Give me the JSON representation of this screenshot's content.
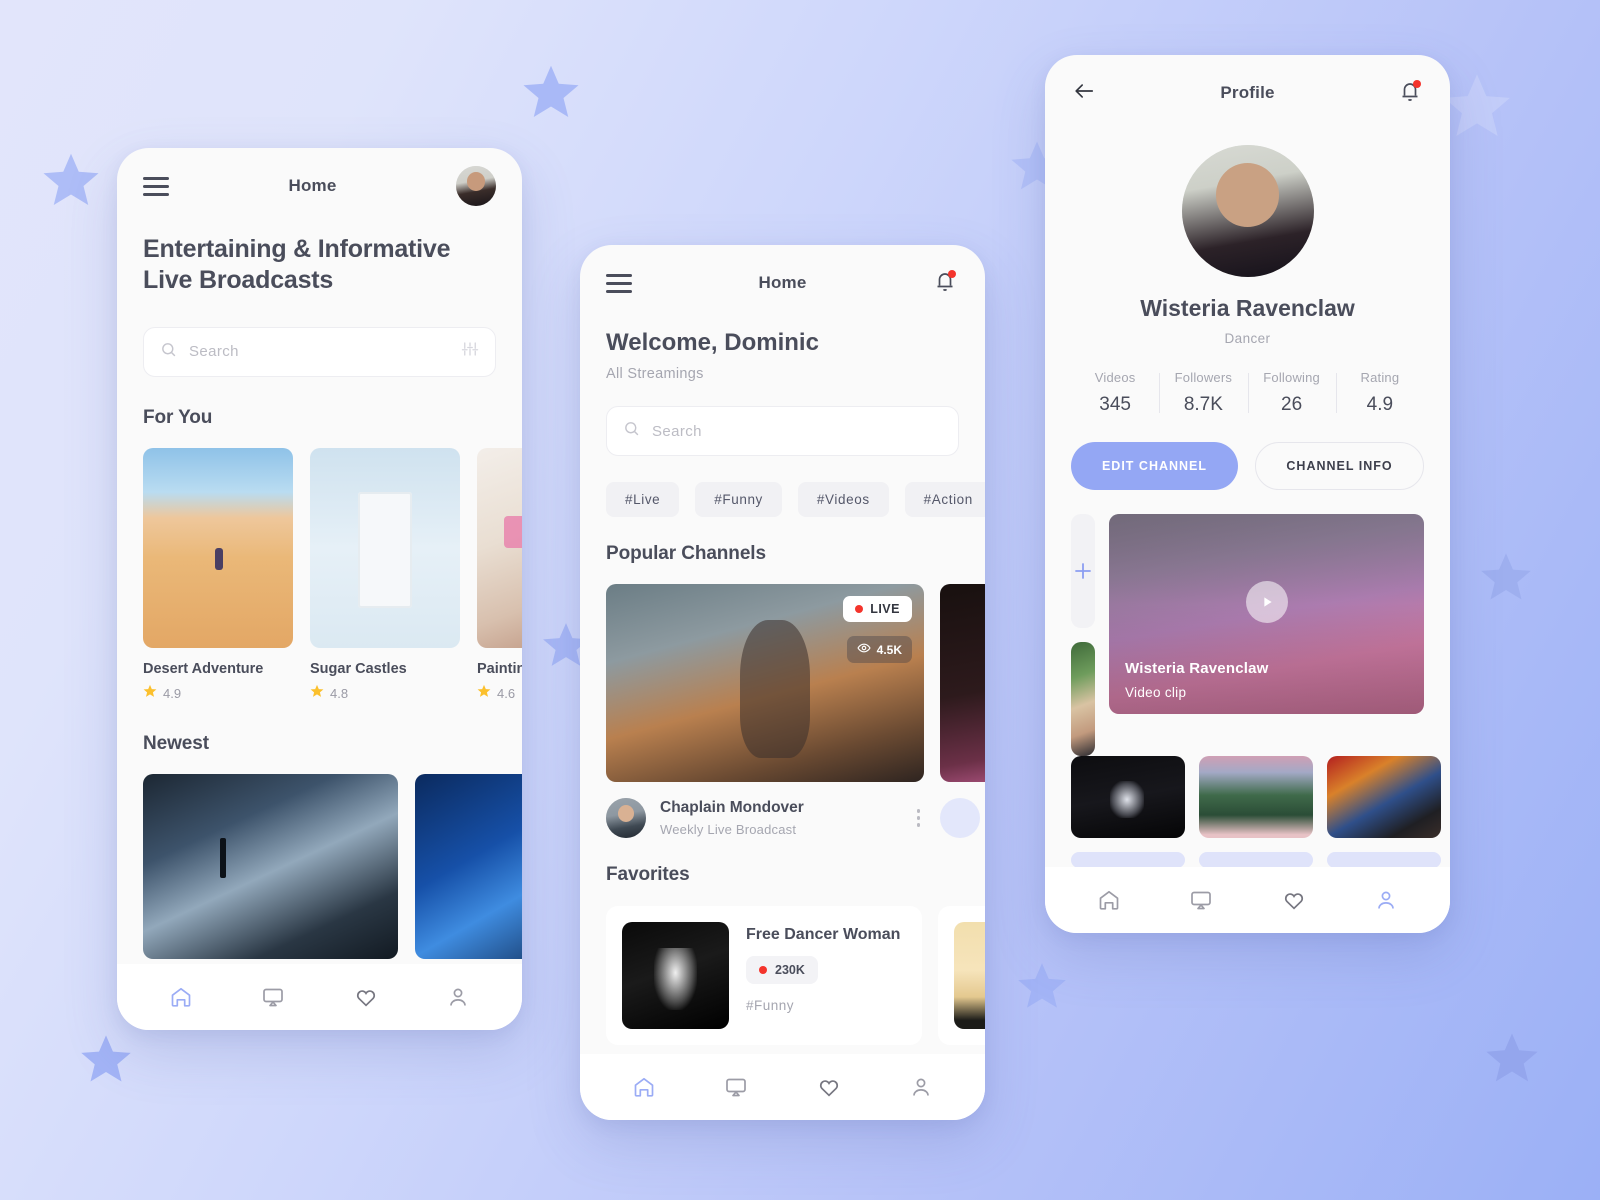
{
  "background": {
    "gradient_from": "#e2e5fb",
    "gradient_to": "#9bb0f6",
    "star_color": "#aebdf7"
  },
  "accent": "#94a7f4",
  "phone1": {
    "header": {
      "title": "Home",
      "menu_icon": "hamburger-icon",
      "avatar": "user-avatar"
    },
    "headline": "Entertaining & Informative Live Broadcasts",
    "search": {
      "placeholder": "Search",
      "icon": "search-icon",
      "filter_icon": "filter-sliders-icon"
    },
    "for_you": {
      "title": "For You",
      "cards": [
        {
          "title": "Desert Adventure",
          "rating": "4.9",
          "art": "desert"
        },
        {
          "title": "Sugar Castles",
          "rating": "4.8",
          "art": "sugar"
        },
        {
          "title": "Painting",
          "rating": "4.6",
          "art": "paint"
        }
      ]
    },
    "newest": {
      "title": "Newest",
      "cards": [
        {
          "art": "concert1"
        },
        {
          "art": "concert2"
        }
      ]
    },
    "nav": [
      {
        "name": "home",
        "icon": "home-icon",
        "active": true
      },
      {
        "name": "cast",
        "icon": "screen-cast-icon",
        "active": false
      },
      {
        "name": "favorites",
        "icon": "heart-icon",
        "active": false
      },
      {
        "name": "profile",
        "icon": "person-icon",
        "active": false
      }
    ]
  },
  "phone2": {
    "header": {
      "title": "Home",
      "menu_icon": "hamburger-icon",
      "bell_icon": "bell-icon"
    },
    "welcome": "Welcome, Dominic",
    "subtitle": "All Streamings",
    "search": {
      "placeholder": "Search",
      "icon": "search-icon"
    },
    "chips": [
      "#Live",
      "#Funny",
      "#Videos",
      "#Action"
    ],
    "popular": {
      "title": "Popular Channels",
      "cards": [
        {
          "live_label": "LIVE",
          "views": "4.5K",
          "name": "Chaplain Mondover",
          "subtitle": "Weekly Live Broadcast",
          "art": "guitar"
        },
        {
          "art": "dark-pink"
        }
      ]
    },
    "favorites": {
      "title": "Favorites",
      "cards": [
        {
          "title": "Free Dancer Woman",
          "count": "230K",
          "tag": "#Funny",
          "art": "ballet-bw"
        },
        {
          "art": "sunset"
        }
      ]
    },
    "nav": [
      {
        "name": "home",
        "icon": "home-icon",
        "active": true
      },
      {
        "name": "cast",
        "icon": "screen-cast-icon",
        "active": false
      },
      {
        "name": "favorites",
        "icon": "heart-icon",
        "active": false
      },
      {
        "name": "profile",
        "icon": "person-icon",
        "active": false
      }
    ]
  },
  "phone3": {
    "header": {
      "title": "Profile",
      "back_icon": "arrow-left-icon",
      "bell_icon": "bell-icon"
    },
    "name": "Wisteria Ravenclaw",
    "role": "Dancer",
    "stats": [
      {
        "label": "Videos",
        "value": "345"
      },
      {
        "label": "Followers",
        "value": "8.7K"
      },
      {
        "label": "Following",
        "value": "26"
      },
      {
        "label": "Rating",
        "value": "4.9"
      }
    ],
    "buttons": {
      "primary": "EDIT CHANNEL",
      "secondary": "CHANNEL INFO"
    },
    "gallery": {
      "add_icon": "plus-icon",
      "feature": {
        "title": "Wisteria Ravenclaw",
        "subtitle": "Video clip",
        "play_icon": "play-icon",
        "art": "stage-feature"
      },
      "thumbs": [
        "blonde",
        "ballet2",
        "park",
        "graffiti"
      ]
    },
    "nav": [
      {
        "name": "home",
        "icon": "home-icon",
        "active": false
      },
      {
        "name": "cast",
        "icon": "screen-cast-icon",
        "active": false
      },
      {
        "name": "favorites",
        "icon": "heart-icon",
        "active": false
      },
      {
        "name": "profile",
        "icon": "person-icon",
        "active": true
      }
    ]
  }
}
